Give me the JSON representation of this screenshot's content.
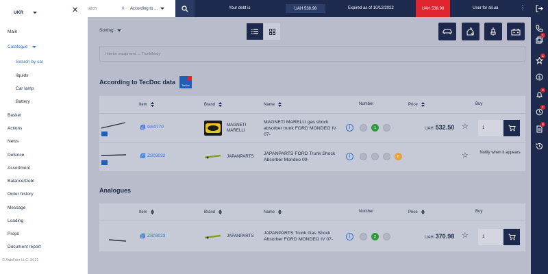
{
  "topbar": {
    "search_placeholder": "earch",
    "search_count": "0",
    "search_scope": "According to ...",
    "debt_label": "Your debt is",
    "debt_amount": "UAH 538.98",
    "expired_label": "Expired as of 10/12/2022",
    "expired_amount": "UAH 538.98",
    "user_label": "User for all.ua",
    "kebab": "⋮"
  },
  "drawer": {
    "language": "UKR",
    "close": "✕",
    "menu": [
      {
        "label": "Main"
      },
      {
        "label": "Catalogue",
        "active": true
      },
      {
        "label": "Search by car",
        "sub": true,
        "active": true
      },
      {
        "label": "liquids",
        "sub": true
      },
      {
        "label": "Car lamp",
        "sub": true
      },
      {
        "label": "Battery",
        "sub": true
      },
      {
        "label": "Basket"
      },
      {
        "label": "Actions"
      },
      {
        "label": "News"
      },
      {
        "label": "Defence"
      },
      {
        "label": "Assortment"
      },
      {
        "label": "Balance/Debt"
      },
      {
        "label": "Order history"
      },
      {
        "label": "Message"
      },
      {
        "label": "Loading"
      },
      {
        "label": "Props"
      },
      {
        "label": "Document report"
      }
    ],
    "copyright": "© Avtolider LLC, 2021"
  },
  "toolbar": {
    "sorting_label": "Sorting"
  },
  "breadcrumb": "Interior equipment → Trunk/body",
  "tecdoc": {
    "title": "According to TecDoc data",
    "logo_text": "TecDoc"
  },
  "analogues_title": "Analogues",
  "table_headers": {
    "item": "Item",
    "brand": "Brand",
    "name": "Name",
    "number": "Number",
    "price": "Price",
    "buy": "Buy"
  },
  "tecdoc_rows": [
    {
      "code": "GS0770",
      "brand": "MAGNETI MARELLI",
      "name": "MAGNETI MARELLI gas shock absorber trunk FORD MONDEO IV 07-",
      "stock": [
        "",
        "1",
        ""
      ],
      "price_currency": "UAH",
      "price_value": "532.50",
      "qty": "1"
    },
    {
      "code": "ZS03032",
      "brand": "JAPANPARTS",
      "name": "JAPANPARTS FORD Trunk Shock Absorber Mondeo 09-",
      "stock": [
        "",
        "",
        "",
        "6"
      ],
      "notify": "Notify when it appears"
    }
  ],
  "analogue_rows": [
    {
      "code": "ZS03023",
      "brand": "JAPANPARTS",
      "name": "JAPANPARTS Trunk Gas Shock Absorber FORD MONDEO IV 07-",
      "stock": [
        "",
        "2",
        ""
      ],
      "price_currency": "UAH",
      "price_value": "370.98",
      "qty": "1"
    }
  ],
  "rail_badges": {
    "copy": "1",
    "star": "1",
    "bell": "4",
    "clock": "1",
    "doc": "6"
  },
  "colors": {
    "navy": "#1d2a4d",
    "accent_blue": "#2f6fd6",
    "alert_red": "#e0252e",
    "stock_green": "#2f9a3d",
    "stock_orange": "#e7a23a"
  }
}
